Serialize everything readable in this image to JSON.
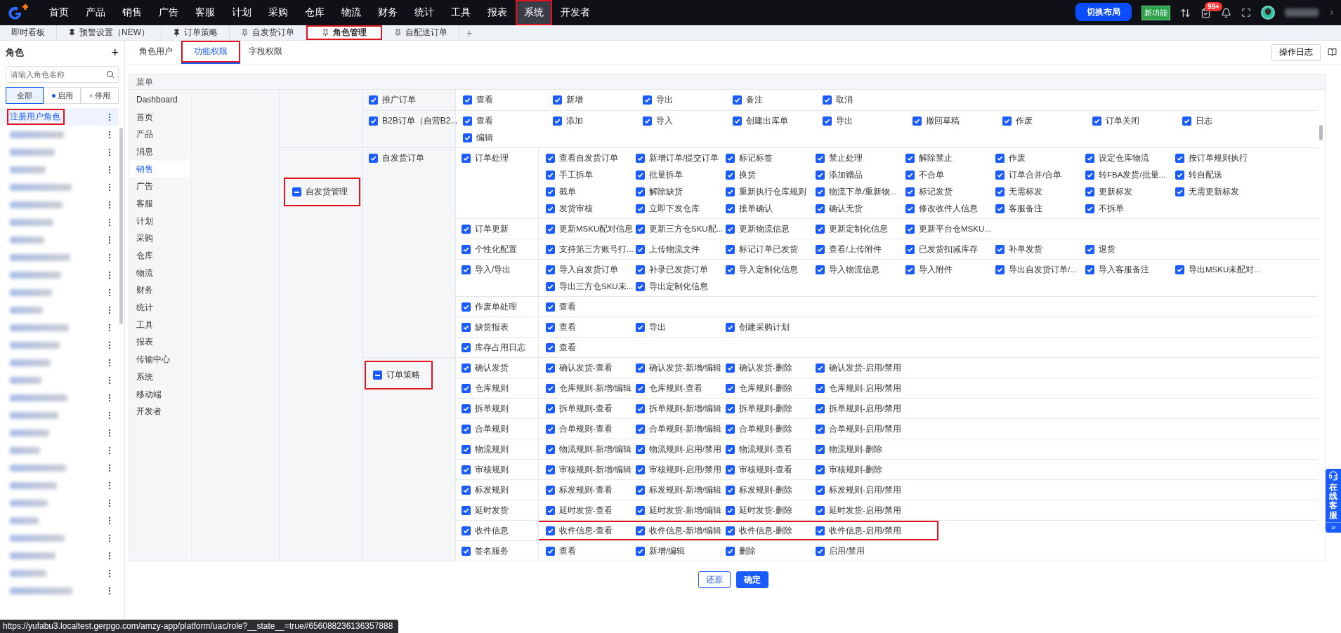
{
  "nav": {
    "items": [
      {
        "label": "首页",
        "selected": false
      },
      {
        "label": "产品",
        "selected": false
      },
      {
        "label": "销售",
        "selected": false
      },
      {
        "label": "广告",
        "selected": false
      },
      {
        "label": "客服",
        "selected": false
      },
      {
        "label": "计划",
        "selected": false
      },
      {
        "label": "采购",
        "selected": false
      },
      {
        "label": "仓库",
        "selected": false
      },
      {
        "label": "物流",
        "selected": false
      },
      {
        "label": "财务",
        "selected": false
      },
      {
        "label": "统计",
        "selected": false
      },
      {
        "label": "工具",
        "selected": false
      },
      {
        "label": "报表",
        "selected": false
      },
      {
        "label": "系统",
        "selected": true,
        "highlighted": true
      },
      {
        "label": "开发者",
        "selected": false
      }
    ],
    "switch_layout": "切换布局",
    "new_feature": "新功能",
    "task_badge": "99+"
  },
  "tabs": [
    {
      "label": "即时看板",
      "pinned": false,
      "selected": false
    },
    {
      "label": "预警设置（NEW）",
      "pinned": true,
      "pin_filled": true,
      "selected": false
    },
    {
      "label": "订单策略",
      "pinned": true,
      "pin_filled": true,
      "selected": false
    },
    {
      "label": "自发货订单",
      "pinned": true,
      "pin_filled": false,
      "selected": false
    },
    {
      "label": "角色管理",
      "pinned": true,
      "pin_filled": false,
      "selected": true,
      "highlighted": true
    },
    {
      "label": "自配送订单",
      "pinned": true,
      "pin_filled": false,
      "selected": false
    }
  ],
  "add_tab": "+",
  "sidebar": {
    "title": "角色",
    "add": "+",
    "search": {
      "placeholder": "请输入角色名称"
    },
    "filters": [
      {
        "label": "全部",
        "selected": true
      },
      {
        "label": "启用",
        "color": "#1a5cff",
        "selected": false
      },
      {
        "label": "停用",
        "color": "#c8cbd0",
        "selected": false
      }
    ],
    "roles": [
      {
        "kind": "named",
        "name": "注册用户角色",
        "selected": true,
        "highlighted": true
      },
      {
        "kind": "blurred",
        "selected": false
      },
      {
        "kind": "blurred",
        "selected": false
      },
      {
        "kind": "blurred",
        "selected": false
      },
      {
        "kind": "blurred",
        "selected": false
      },
      {
        "kind": "blurred",
        "selected": false
      },
      {
        "kind": "blurred",
        "selected": false
      },
      {
        "kind": "blurred",
        "selected": false
      },
      {
        "kind": "blurred",
        "selected": false
      },
      {
        "kind": "blurred",
        "selected": false
      },
      {
        "kind": "blurred",
        "selected": false
      },
      {
        "kind": "blurred",
        "selected": false
      },
      {
        "kind": "blurred",
        "selected": false
      },
      {
        "kind": "blurred",
        "selected": false
      },
      {
        "kind": "blurred",
        "selected": false
      },
      {
        "kind": "blurred",
        "selected": false
      },
      {
        "kind": "blurred",
        "selected": false
      },
      {
        "kind": "blurred",
        "selected": false
      },
      {
        "kind": "blurred",
        "selected": false
      },
      {
        "kind": "blurred",
        "selected": false
      },
      {
        "kind": "blurred",
        "selected": false
      },
      {
        "kind": "blurred",
        "selected": false
      },
      {
        "kind": "blurred",
        "selected": false
      },
      {
        "kind": "blurred",
        "selected": false
      },
      {
        "kind": "blurred",
        "selected": false
      },
      {
        "kind": "blurred",
        "selected": false
      },
      {
        "kind": "blurred",
        "selected": false
      },
      {
        "kind": "blurred",
        "selected": false
      }
    ]
  },
  "subtabs": [
    {
      "label": "角色用户",
      "selected": false
    },
    {
      "label": "功能权限",
      "selected": true,
      "highlighted": true
    },
    {
      "label": "字段权限",
      "selected": false
    }
  ],
  "log_button": "操作日志",
  "menu": {
    "title": "菜单",
    "items": [
      {
        "label": "Dashboard",
        "selected": false
      },
      {
        "label": "首页",
        "selected": false
      },
      {
        "label": "产品",
        "selected": false
      },
      {
        "label": "消息",
        "selected": false
      },
      {
        "label": "销售",
        "selected": true
      },
      {
        "label": "广告",
        "selected": false
      },
      {
        "label": "客服",
        "selected": false
      },
      {
        "label": "计划",
        "selected": false
      },
      {
        "label": "采购",
        "selected": false
      },
      {
        "label": "仓库",
        "selected": false
      },
      {
        "label": "物流",
        "selected": false
      },
      {
        "label": "财务",
        "selected": false
      },
      {
        "label": "统计",
        "selected": false
      },
      {
        "label": "工具",
        "selected": false
      },
      {
        "label": "报表",
        "selected": false
      },
      {
        "label": "传输中心",
        "selected": false
      },
      {
        "label": "系统",
        "selected": false
      },
      {
        "label": "移动端",
        "selected": false
      },
      {
        "label": "开发者",
        "selected": false
      }
    ]
  },
  "tree": [
    {
      "modules": [
        {
          "label": "推广订单",
          "checked": true,
          "permissions": [
            {
              "label": "查看",
              "checked": true
            },
            {
              "label": "新增",
              "checked": true
            },
            {
              "label": "导出",
              "checked": true
            },
            {
              "label": "备注",
              "checked": true
            },
            {
              "label": "取消",
              "checked": true
            }
          ]
        },
        {
          "label": "B2B订单（自营B2...",
          "checked": true,
          "permissions": [
            {
              "label": "查看",
              "checked": true
            },
            {
              "label": "添加",
              "checked": true
            },
            {
              "label": "导入",
              "checked": true
            },
            {
              "label": "创建出库单",
              "checked": true
            },
            {
              "label": "导出",
              "checked": true
            },
            {
              "label": "撤回草稿",
              "checked": true
            },
            {
              "label": "作废",
              "checked": true
            },
            {
              "label": "订单关闭",
              "checked": true
            },
            {
              "label": "日志",
              "checked": true
            },
            {
              "label": "编辑",
              "checked": true
            }
          ]
        }
      ]
    },
    {
      "label": "自发货管理",
      "indeterminate": true,
      "highlighted": true,
      "modules": [
        {
          "label": "自发货订单",
          "checked": true,
          "groups": [
            {
              "label": "订单处理",
              "checked": true,
              "permissions": [
                {
                  "label": "查看自发货订单",
                  "checked": true
                },
                {
                  "label": "新增订单/提交订单",
                  "checked": true
                },
                {
                  "label": "标记标签",
                  "checked": true
                },
                {
                  "label": "禁止处理",
                  "checked": true
                },
                {
                  "label": "解除禁止",
                  "checked": true
                },
                {
                  "label": "作废",
                  "checked": true
                },
                {
                  "label": "设定仓库物流",
                  "checked": true
                },
                {
                  "label": "按订单规则执行",
                  "checked": true
                },
                {
                  "label": "手工拆单",
                  "checked": true
                },
                {
                  "label": "批量拆单",
                  "checked": true
                },
                {
                  "label": "换货",
                  "checked": true
                },
                {
                  "label": "添加赠品",
                  "checked": true
                },
                {
                  "label": "不合单",
                  "checked": true
                },
                {
                  "label": "订单合并/合单",
                  "checked": true
                },
                {
                  "label": "转FBA发货/批量...",
                  "checked": true
                },
                {
                  "label": "转自配送",
                  "checked": true
                },
                {
                  "label": "截单",
                  "checked": true
                },
                {
                  "label": "解除缺货",
                  "checked": true
                },
                {
                  "label": "重新执行仓库规则",
                  "checked": true
                },
                {
                  "label": "物流下单/重新物...",
                  "checked": true
                },
                {
                  "label": "标记发货",
                  "checked": true
                },
                {
                  "label": "无需标发",
                  "checked": true
                },
                {
                  "label": "更新标发",
                  "checked": true
                },
                {
                  "label": "无需更新标发",
                  "checked": true
                },
                {
                  "label": "发货审核",
                  "checked": true
                },
                {
                  "label": "立即下发仓库",
                  "checked": true
                },
                {
                  "label": "接单确认",
                  "checked": true
                },
                {
                  "label": "确认无货",
                  "checked": true
                },
                {
                  "label": "修改收件人信息",
                  "checked": true
                },
                {
                  "label": "客服备注",
                  "checked": true
                },
                {
                  "label": "不拆单",
                  "checked": true
                }
              ]
            },
            {
              "label": "订单更新",
              "checked": true,
              "permissions": [
                {
                  "label": "更新MSKU配对信息",
                  "checked": true
                },
                {
                  "label": "更新三方仓SKU配...",
                  "checked": true
                },
                {
                  "label": "更新物流信息",
                  "checked": true
                },
                {
                  "label": "更新定制化信息",
                  "checked": true
                },
                {
                  "label": "更新平台仓MSKU...",
                  "checked": true
                }
              ]
            },
            {
              "label": "个性化配置",
              "checked": true,
              "permissions": [
                {
                  "label": "支持第三方账号打...",
                  "checked": true
                },
                {
                  "label": "上传物流文件",
                  "checked": true
                },
                {
                  "label": "标记订单已发货",
                  "checked": true
                },
                {
                  "label": "查看/上传附件",
                  "checked": true
                },
                {
                  "label": "已发货扣减库存",
                  "checked": true
                },
                {
                  "label": "补单发货",
                  "checked": true
                },
                {
                  "label": "退货",
                  "checked": true
                }
              ]
            },
            {
              "label": "导入/导出",
              "checked": true,
              "permissions": [
                {
                  "label": "导入自发货订单",
                  "checked": true
                },
                {
                  "label": "补录已发货订单",
                  "checked": true
                },
                {
                  "label": "导入定制化信息",
                  "checked": true
                },
                {
                  "label": "导入物流信息",
                  "checked": true
                },
                {
                  "label": "导入附件",
                  "checked": true
                },
                {
                  "label": "导出自发货订单/...",
                  "checked": true
                },
                {
                  "label": "导入客服备注",
                  "checked": true
                },
                {
                  "label": "导出MSKU未配对...",
                  "checked": true
                },
                {
                  "label": "导出三方仓SKU未...",
                  "checked": true
                },
                {
                  "label": "导出定制化信息",
                  "checked": true
                }
              ]
            },
            {
              "label": "作废单处理",
              "checked": true,
              "permissions": [
                {
                  "label": "查看",
                  "checked": true
                }
              ]
            },
            {
              "label": "缺货报表",
              "checked": true,
              "permissions": [
                {
                  "label": "查看",
                  "checked": true
                },
                {
                  "label": "导出",
                  "checked": true
                },
                {
                  "label": "创建采购计划",
                  "checked": true
                }
              ]
            },
            {
              "label": "库存占用日志",
              "checked": true,
              "permissions": [
                {
                  "label": "查看",
                  "checked": true
                }
              ]
            }
          ]
        },
        {
          "label": "订单策略",
          "indeterminate": true,
          "highlighted": true,
          "groups": [
            {
              "label": "确认发货",
              "checked": true,
              "permissions": [
                {
                  "label": "确认发货-查看",
                  "checked": true
                },
                {
                  "label": "确认发货-新增/编辑",
                  "checked": true
                },
                {
                  "label": "确认发货-删除",
                  "checked": true
                },
                {
                  "label": "确认发货-启用/禁用",
                  "checked": true
                }
              ]
            },
            {
              "label": "仓库规则",
              "checked": true,
              "permissions": [
                {
                  "label": "仓库规则-新增/编辑",
                  "checked": true
                },
                {
                  "label": "仓库规则-查看",
                  "checked": true
                },
                {
                  "label": "仓库规则-删除",
                  "checked": true
                },
                {
                  "label": "仓库规则-启用/禁用",
                  "checked": true
                }
              ]
            },
            {
              "label": "拆单规则",
              "checked": true,
              "permissions": [
                {
                  "label": "拆单规则-查看",
                  "checked": true
                },
                {
                  "label": "拆单规则-新增/编辑",
                  "checked": true
                },
                {
                  "label": "拆单规则-删除",
                  "checked": true
                },
                {
                  "label": "拆单规则-启用/禁用",
                  "checked": true
                }
              ]
            },
            {
              "label": "合单规则",
              "checked": true,
              "permissions": [
                {
                  "label": "合单规则-查看",
                  "checked": true
                },
                {
                  "label": "合单规则-新增/编辑",
                  "checked": true
                },
                {
                  "label": "合单规则-删除",
                  "checked": true
                },
                {
                  "label": "合单规则-启用/禁用",
                  "checked": true
                }
              ]
            },
            {
              "label": "物流规则",
              "checked": true,
              "permissions": [
                {
                  "label": "物流规则-新增/编辑",
                  "checked": true
                },
                {
                  "label": "物流规则-启用/禁用",
                  "checked": true
                },
                {
                  "label": "物流规则-查看",
                  "checked": true
                },
                {
                  "label": "物流规则-删除",
                  "checked": true
                }
              ]
            },
            {
              "label": "审核规则",
              "checked": true,
              "permissions": [
                {
                  "label": "审核规则-新增/编辑",
                  "checked": true
                },
                {
                  "label": "审核规则-启用/禁用",
                  "checked": true
                },
                {
                  "label": "审核规则-查看",
                  "checked": true
                },
                {
                  "label": "审核规则-删除",
                  "checked": true
                }
              ]
            },
            {
              "label": "标发规则",
              "checked": true,
              "permissions": [
                {
                  "label": "标发规则-查看",
                  "checked": true
                },
                {
                  "label": "标发规则-新增/编辑",
                  "checked": true
                },
                {
                  "label": "标发规则-删除",
                  "checked": true
                },
                {
                  "label": "标发规则-启用/禁用",
                  "checked": true
                }
              ]
            },
            {
              "label": "延时发货",
              "checked": true,
              "permissions": [
                {
                  "label": "延时发货-查看",
                  "checked": true
                },
                {
                  "label": "延时发货-新增/编辑",
                  "checked": true
                },
                {
                  "label": "延时发货-删除",
                  "checked": true
                },
                {
                  "label": "延时发货-启用/禁用",
                  "checked": true
                }
              ]
            },
            {
              "label": "收件信息",
              "checked": true,
              "highlighted": true,
              "permissions": [
                {
                  "label": "收件信息-查看",
                  "checked": true
                },
                {
                  "label": "收件信息-新增/编辑",
                  "checked": true
                },
                {
                  "label": "收件信息-删除",
                  "checked": true
                },
                {
                  "label": "收件信息-启用/禁用",
                  "checked": true
                }
              ]
            },
            {
              "label": "签名服务",
              "checked": true,
              "permissions": [
                {
                  "label": "查看",
                  "checked": true
                },
                {
                  "label": "新增/编辑",
                  "checked": true
                },
                {
                  "label": "删除",
                  "checked": true
                },
                {
                  "label": "启用/禁用",
                  "checked": true
                }
              ]
            }
          ]
        }
      ]
    }
  ],
  "buttons": {
    "reset": "还原",
    "confirm": "确定"
  },
  "chat_widget": {
    "label": "在线客服",
    "collapse": "»"
  },
  "status_url": "https://yufabu3.localtest.gerpgo.com/amzy-app/platform/uac/role?__state__=true#656088236136357888"
}
